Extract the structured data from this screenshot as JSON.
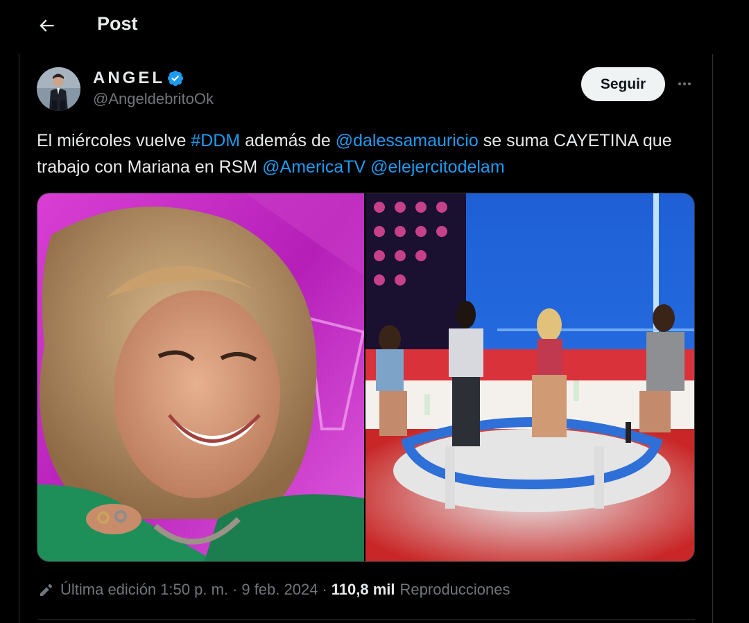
{
  "header": {
    "title": "Post"
  },
  "tweet": {
    "author": {
      "display_name": "ANGEL",
      "handle": "@AngeldebritoOk",
      "verified": true
    },
    "follow_label": "Seguir",
    "text_parts": {
      "p1": "El miércoles vuelve ",
      "hashtag": "#DDM",
      "p2": " además de ",
      "mention1": "@dalessamauricio",
      "p3": " se suma CAYETINA que trabajo con Mariana en RSM ",
      "mention2": "@AmericaTV",
      "p4": " ",
      "mention3": "@elejercitodelam"
    },
    "meta": {
      "edited_label": "Última edición",
      "time": "1:50 p. m.",
      "separator": "·",
      "date": "9 feb. 2024",
      "views_count": "110,8 mil",
      "views_label": "Reproducciones"
    }
  },
  "colors": {
    "background": "#000000",
    "text": "#e7e9ea",
    "muted": "#71767b",
    "link": "#1d9bf0",
    "border": "#2f3336",
    "follow_bg": "#eff3f4"
  },
  "icons": {
    "back": "arrow-left-icon",
    "verified": "verified-badge-icon",
    "more": "more-horizontal-icon",
    "edit": "pencil-icon"
  }
}
